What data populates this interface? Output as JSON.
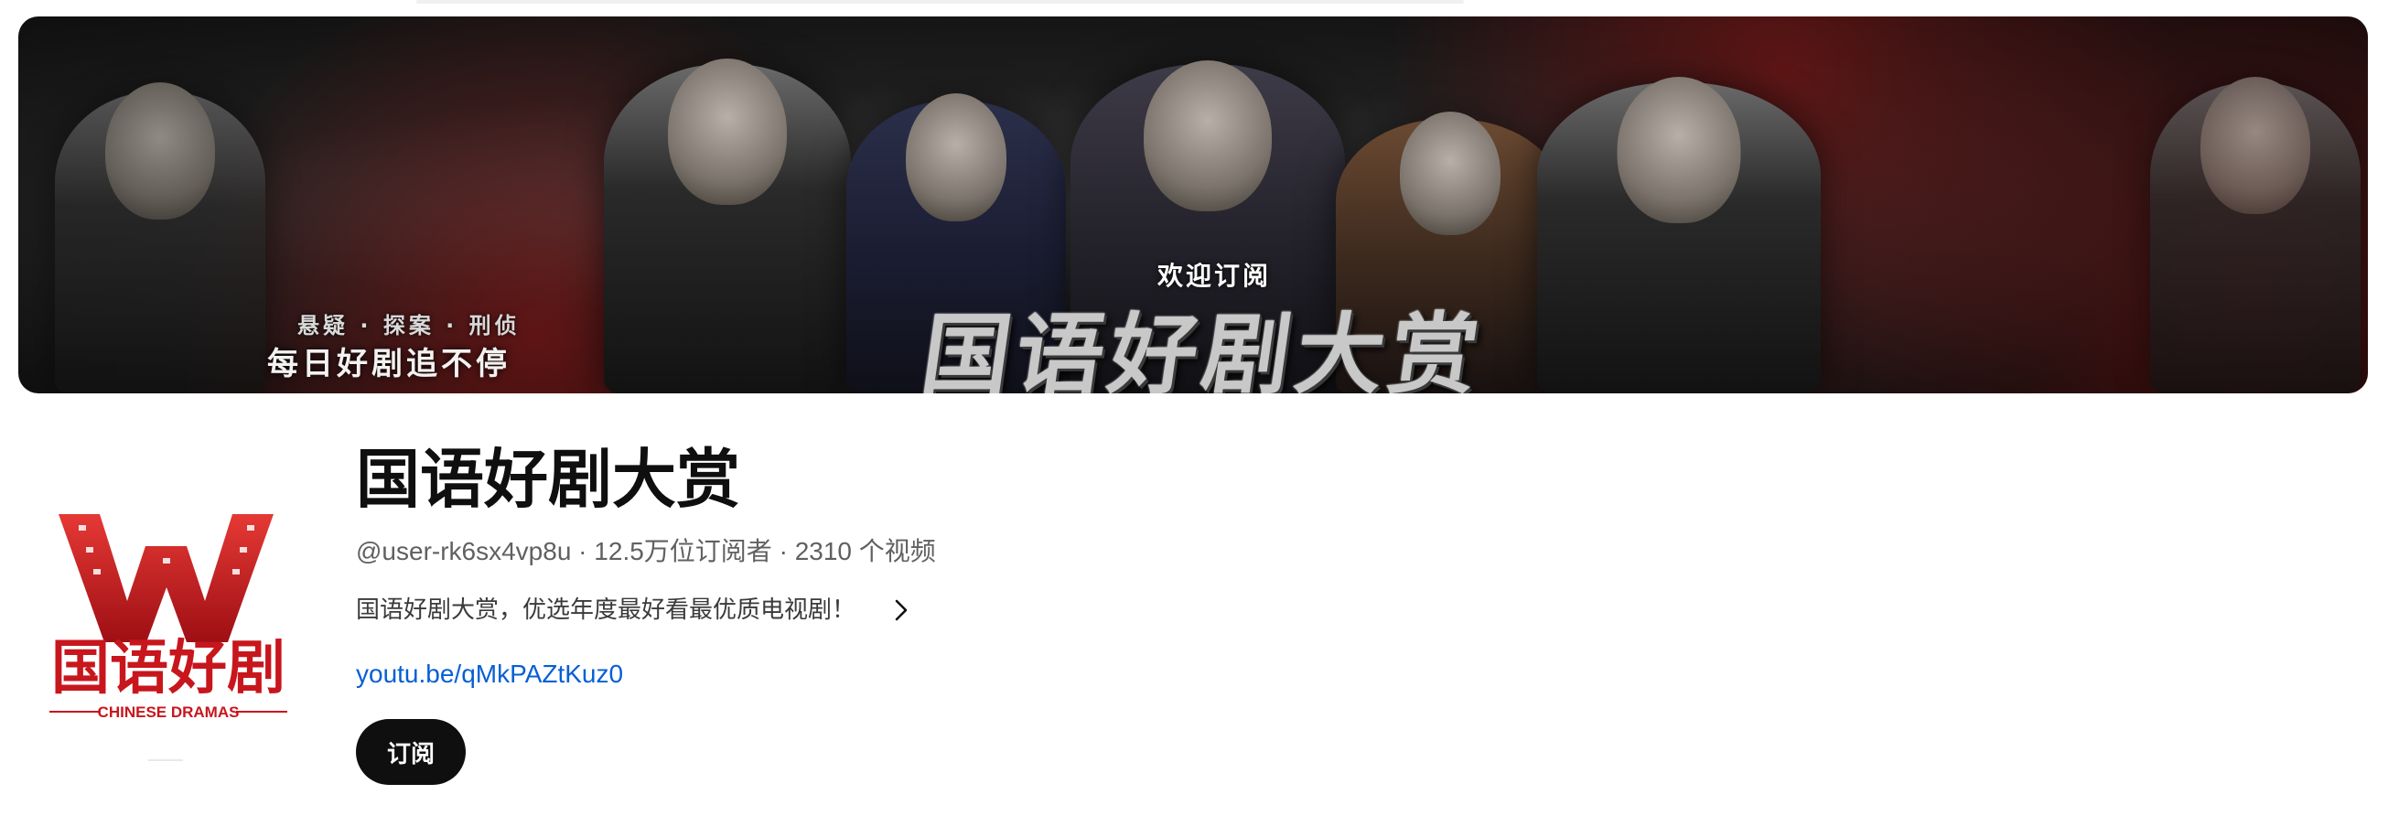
{
  "banner": {
    "tagline_top": "悬疑 · 探案 · 刑侦",
    "tagline": "每日好剧追不停",
    "welcome": "欢迎订阅",
    "title": "国语好剧大赏"
  },
  "avatar": {
    "logo_text": "国语好剧",
    "logo_subtext": "CHINESE DRAMAS",
    "accent_color": "#c8161d"
  },
  "channel": {
    "name": "国语好剧大赏",
    "handle": "@user-rk6sx4vp8u",
    "subscribers": "12.5万位订阅者",
    "videos": "2310 个视频",
    "separator": " · ",
    "description": "国语好剧大赏，优选年度最好看最优质电视剧！",
    "link": "youtu.be/qMkPAZtKuz0",
    "subscribe_label": "订阅"
  },
  "colors": {
    "link": "#065fd4",
    "subscribe_bg": "#0f0f0f",
    "meta_text": "#606060"
  }
}
